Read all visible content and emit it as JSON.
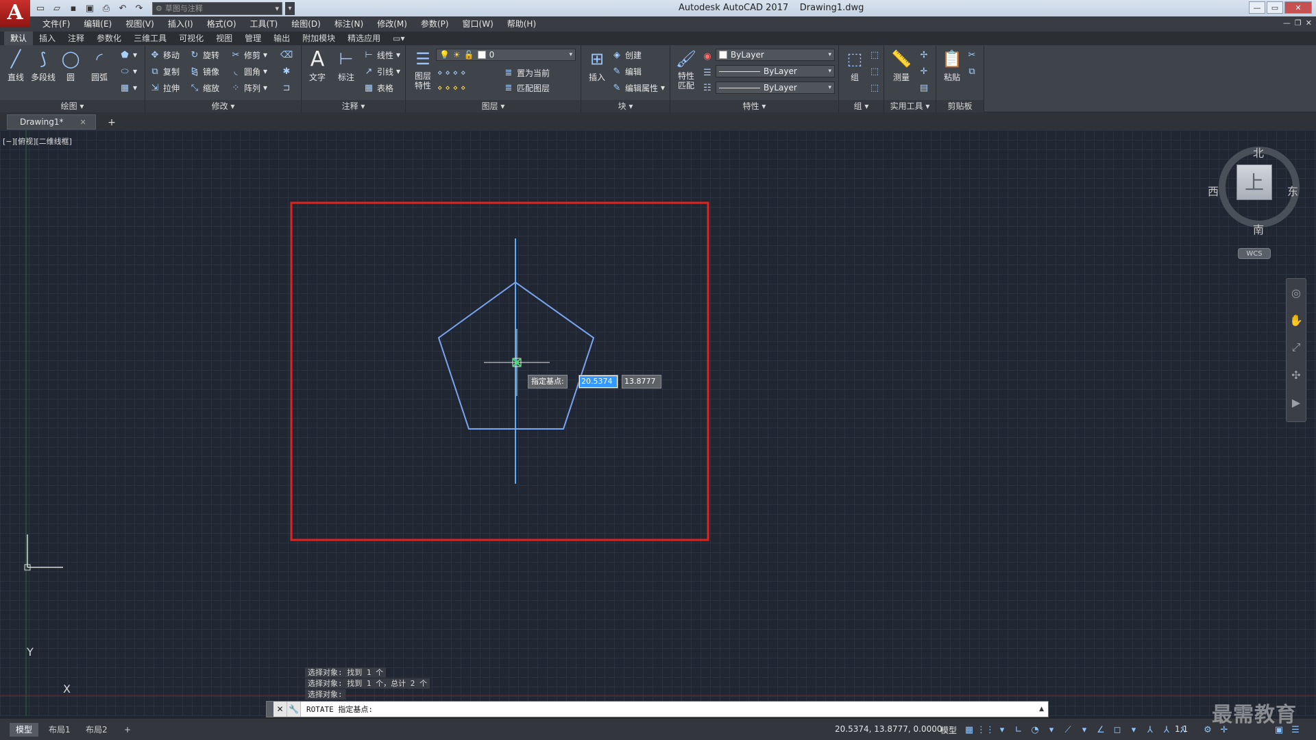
{
  "title": "Autodesk AutoCAD 2017    Drawing1.dwg",
  "app_logo": "A",
  "workspace": "草图与注释",
  "menu": [
    "文件(F)",
    "编辑(E)",
    "视图(V)",
    "插入(I)",
    "格式(O)",
    "工具(T)",
    "绘图(D)",
    "标注(N)",
    "修改(M)",
    "参数(P)",
    "窗口(W)",
    "帮助(H)"
  ],
  "ribbon_tabs": [
    "默认",
    "插入",
    "注释",
    "参数化",
    "三维工具",
    "可视化",
    "视图",
    "管理",
    "输出",
    "附加模块",
    "精选应用"
  ],
  "panels": {
    "draw": {
      "title": "绘图 ▾",
      "tools": [
        "直线",
        "多段线",
        "圆",
        "圆弧"
      ]
    },
    "modify": {
      "title": "修改 ▾",
      "tools": [
        "移动",
        "旋转",
        "修剪",
        "复制",
        "镜像",
        "圆角",
        "拉伸",
        "缩放",
        "阵列"
      ]
    },
    "annotation": {
      "title": "注释 ▾",
      "big": [
        "文字",
        "标注"
      ],
      "small": [
        "线性",
        "引线",
        "表格"
      ]
    },
    "layers": {
      "title": "图层 ▾",
      "big": "图层\n特性",
      "layer_value": "0",
      "small": [
        "置为当前",
        "匹配图层"
      ]
    },
    "block": {
      "title": "块 ▾",
      "big": "插入",
      "small": [
        "创建",
        "编辑",
        "编辑属性"
      ]
    },
    "properties": {
      "title": "特性 ▾",
      "big": "特性\n匹配",
      "color": "ByLayer",
      "linetype": "ByLayer",
      "lineweight": "ByLayer"
    },
    "groups": {
      "title": "组 ▾",
      "big": "组"
    },
    "utilities": {
      "title": "实用工具 ▾",
      "big": "测量"
    },
    "clipboard": {
      "title": "剪贴板",
      "big": "粘贴"
    }
  },
  "doc_tab": "Drawing1*",
  "viewport_label": "[−][俯视][二维线框]",
  "dynamic_input": {
    "label": "指定基点:",
    "x": "20.5374",
    "y": "13.8777"
  },
  "viewcube": {
    "north": "北",
    "south": "南",
    "east": "东",
    "west": "西",
    "face": "上",
    "wcs": "WCS"
  },
  "ucs": {
    "x": "X",
    "y": "Y"
  },
  "command_history": [
    "选择对象: 找到 1 个",
    "选择对象: 找到 1 个，总计 2 个",
    "选择对象:"
  ],
  "command_prompt": "ROTATE 指定基点:",
  "layout_tabs": [
    "模型",
    "布局1",
    "布局2"
  ],
  "status": {
    "coords": "20.5374, 13.8777, 0.0000",
    "model": "模型",
    "scale": "1:1"
  },
  "watermark": "最需教育",
  "colors": {
    "canvas": "#212732",
    "geometry": "#6f9ef0",
    "highlight_box": "#e0231f",
    "accent": "#3399ff"
  }
}
